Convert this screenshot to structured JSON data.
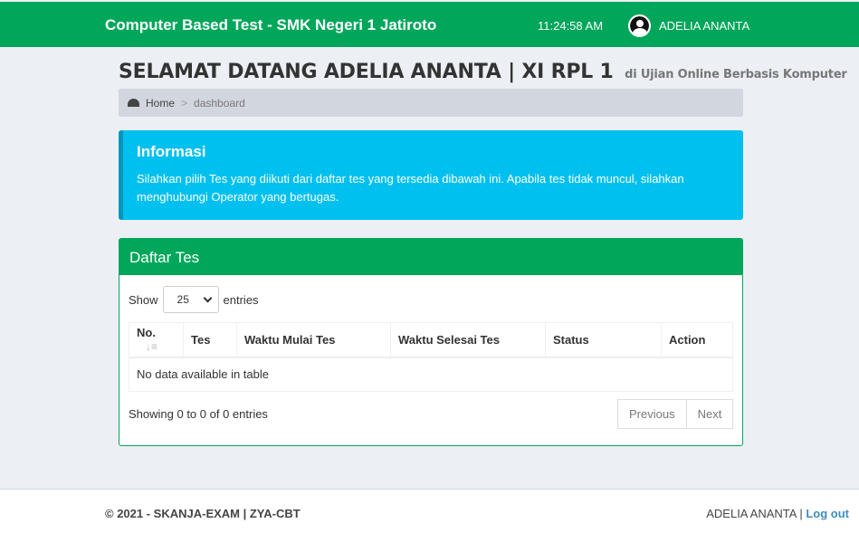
{
  "header": {
    "brand": "Computer Based Test - SMK Negeri 1 Jatiroto",
    "clock": "11:24:58 AM",
    "user_name": "ADELIA ANANTA"
  },
  "page": {
    "title": "SELAMAT DATANG ADELIA ANANTA | XI RPL 1",
    "subtitle": "di Ujian Online Berbasis Komputer"
  },
  "breadcrumb": {
    "home": "Home",
    "separator": ">",
    "current": "dashboard"
  },
  "callout": {
    "title": "Informasi",
    "text": "Silahkan pilih Tes yang diikuti dari daftar tes yang tersedia dibawah ini. Apabila tes tidak muncul, silahkan menghubungi Operator yang bertugas."
  },
  "daftar_tes": {
    "title": "Daftar Tes",
    "show_label": "Show",
    "entries_value": "25",
    "entries_label": "entries",
    "columns": [
      "No.",
      "Tes",
      "Waktu Mulai Tes",
      "Waktu Selesai Tes",
      "Status",
      "Action"
    ],
    "empty_message": "No data available in table",
    "info": "Showing 0 to 0 of 0 entries",
    "prev_label": "Previous",
    "next_label": "Next"
  },
  "footer": {
    "copyright": "© 2021 - SKANJA-EXAM | ZYA-CBT",
    "user_name": "ADELIA ANANTA",
    "separator": "|",
    "logout": "Log out"
  },
  "colors": {
    "primary": "#00a65a",
    "info": "#00c0ef",
    "background": "#ecf0f5"
  }
}
